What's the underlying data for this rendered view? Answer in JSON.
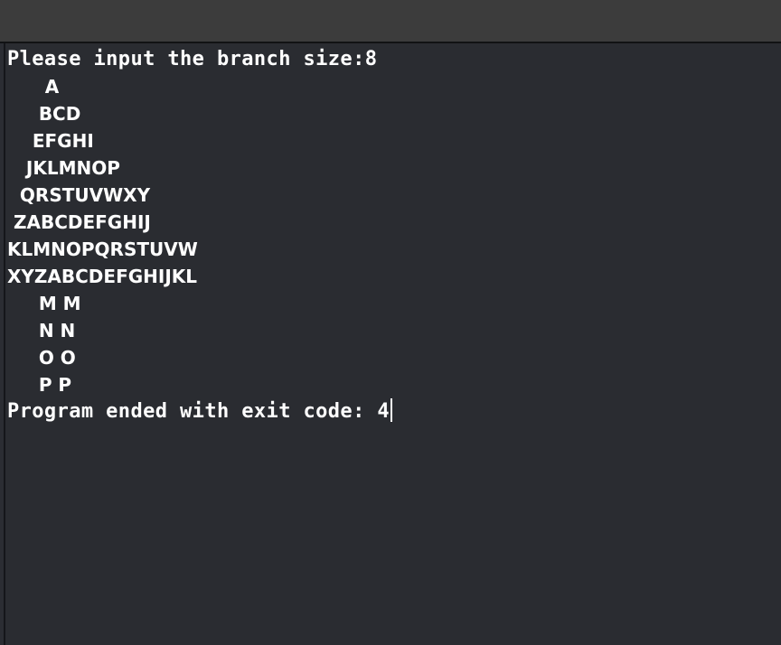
{
  "console": {
    "prompt": "Please input the branch size:8",
    "pattern": [
      "      A",
      "     BCD",
      "    EFGHI",
      "   JKLMNOP",
      "  QRSTUVWXY",
      " ZABCDEFGHIJ",
      "KLMNOPQRSTUVW",
      "XYZABCDEFGHIJKL",
      "     M M",
      "     N N",
      "     O O",
      "     P P"
    ],
    "exit_message": "Program ended with exit code: 4"
  }
}
